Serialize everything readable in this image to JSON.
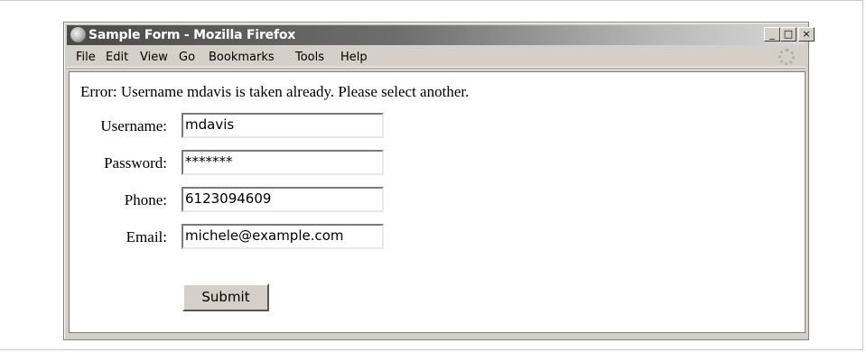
{
  "window": {
    "title": "Sample Form - Mozilla Firefox",
    "buttons": {
      "minimize": "_",
      "maximize": "□",
      "close": "×"
    }
  },
  "menu": [
    {
      "label": "File"
    },
    {
      "label": "Edit"
    },
    {
      "label": "View"
    },
    {
      "label": "Go"
    },
    {
      "label": "Bookmarks"
    },
    {
      "label": "Tools"
    },
    {
      "label": "Help"
    }
  ],
  "form": {
    "error": "Error: Username mdavis is taken already. Please select another.",
    "username": {
      "label": "Username:",
      "value": "mdavis"
    },
    "password": {
      "label": "Password:",
      "value": "*******"
    },
    "phone": {
      "label": "Phone:",
      "value": "6123094609"
    },
    "email": {
      "label": "Email:",
      "value": "michele@example.com"
    },
    "submit": "Submit"
  }
}
